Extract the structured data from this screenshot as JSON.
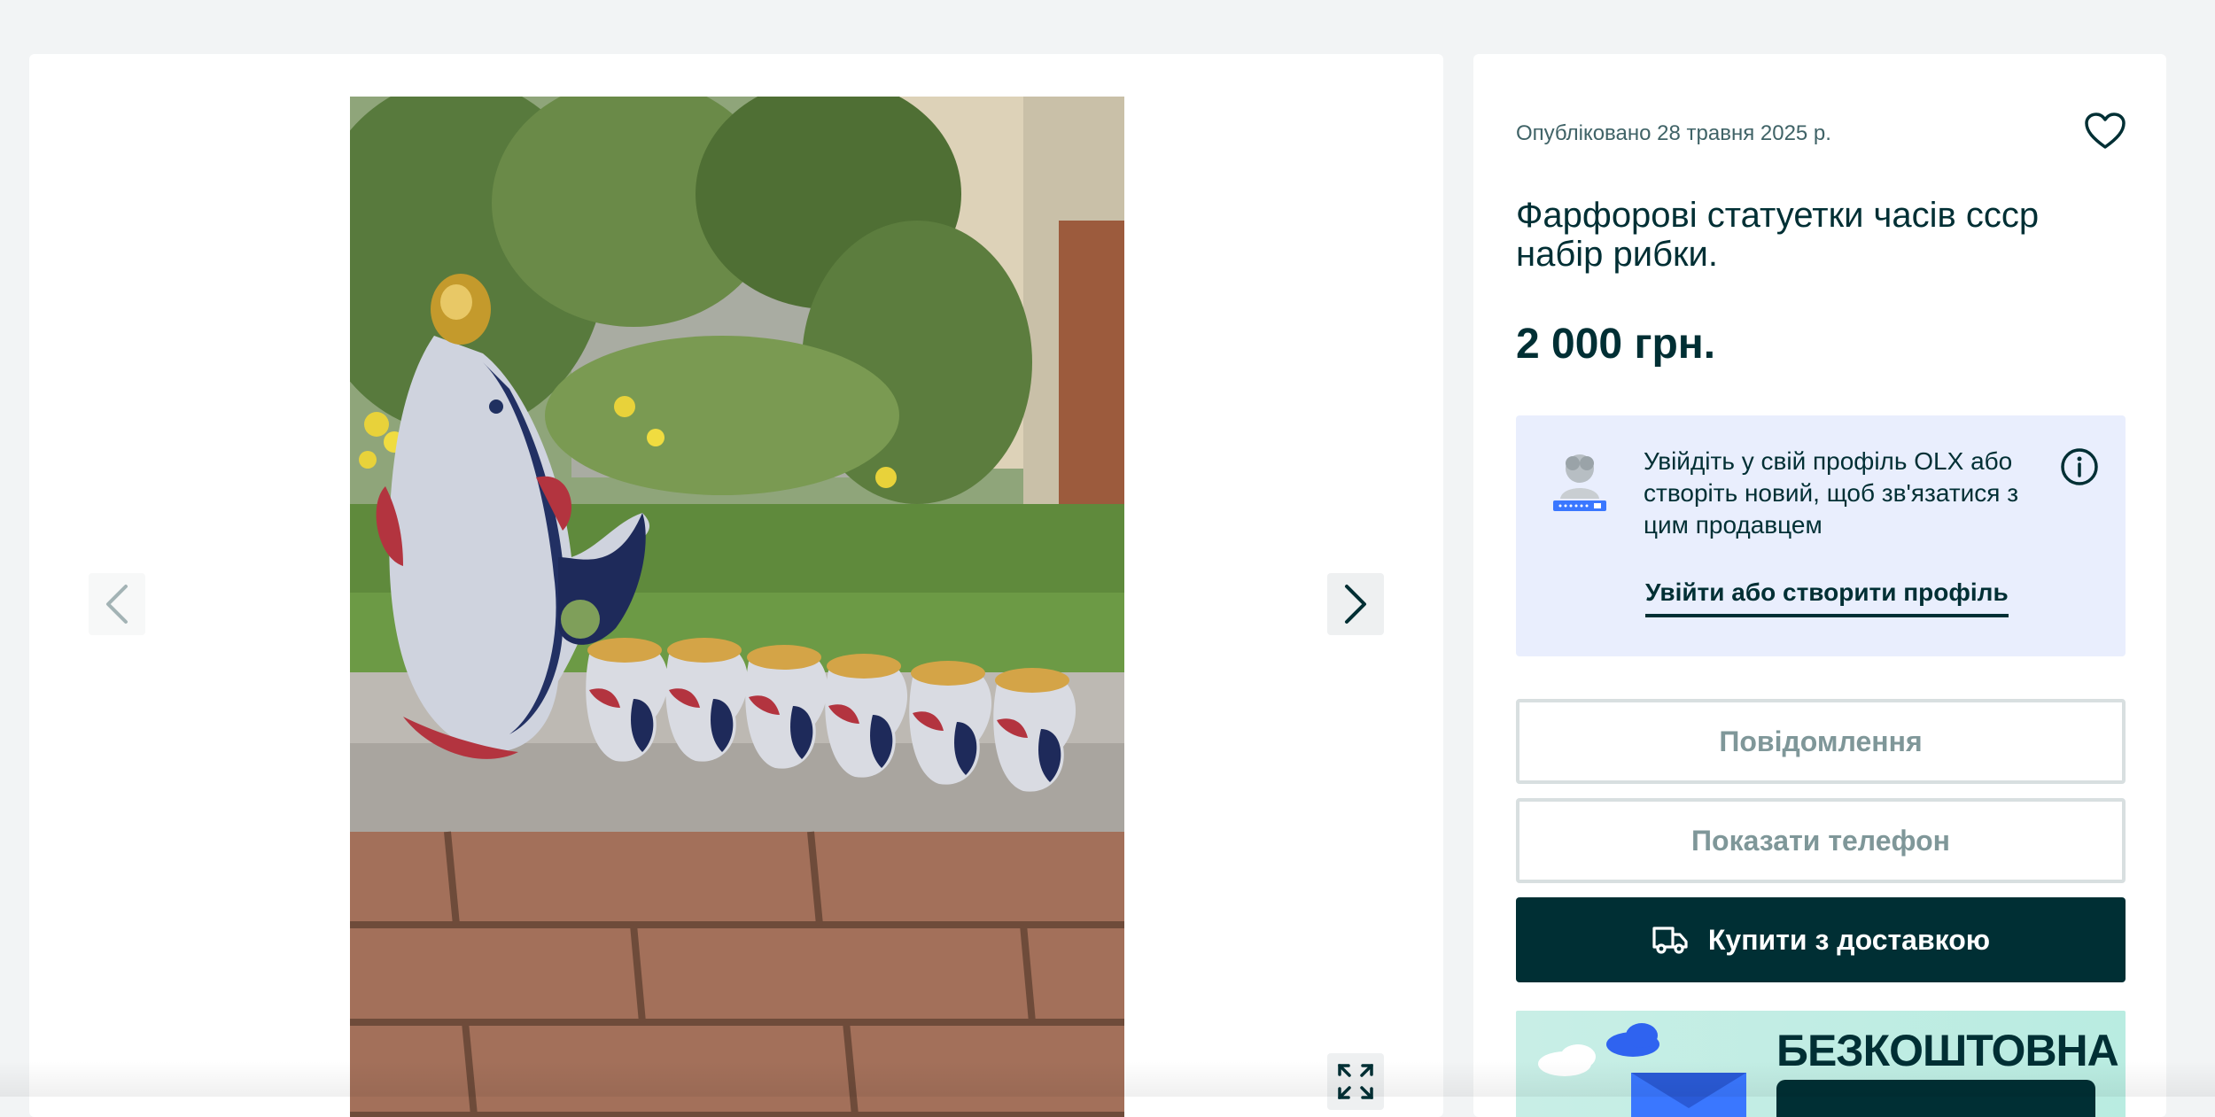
{
  "gallery": {
    "photo_alt": "Фарфорові статуетки часів ссср набір рибки.",
    "prev_icon": "chevron-left-icon",
    "next_icon": "chevron-right-icon",
    "expand_icon": "expand-icon"
  },
  "listing": {
    "posted": "Опубліковано 28 травня 2025 р.",
    "title": "Фарфорові статуетки часів ссср набір рибки.",
    "price": "2 000 грн.",
    "favorite_icon": "heart-icon"
  },
  "login_prompt": {
    "text": "Увійдіть у свій профіль OLX або створіть новий, щоб зв'язатися з цим продавцем",
    "link": "Увійти або створити профіль",
    "info_icon": "info-icon"
  },
  "actions": {
    "message": "Повідомлення",
    "show_phone": "Показати телефон",
    "buy_delivery": "Купити з доставкою",
    "buy_icon": "truck-icon"
  },
  "promo": {
    "headline": "БЕЗКОШТОВНА"
  },
  "colors": {
    "primary": "#002f34",
    "page_bg": "#f2f4f5",
    "login_bg": "#e9eefd",
    "promo_bg": "#c8eee6"
  }
}
